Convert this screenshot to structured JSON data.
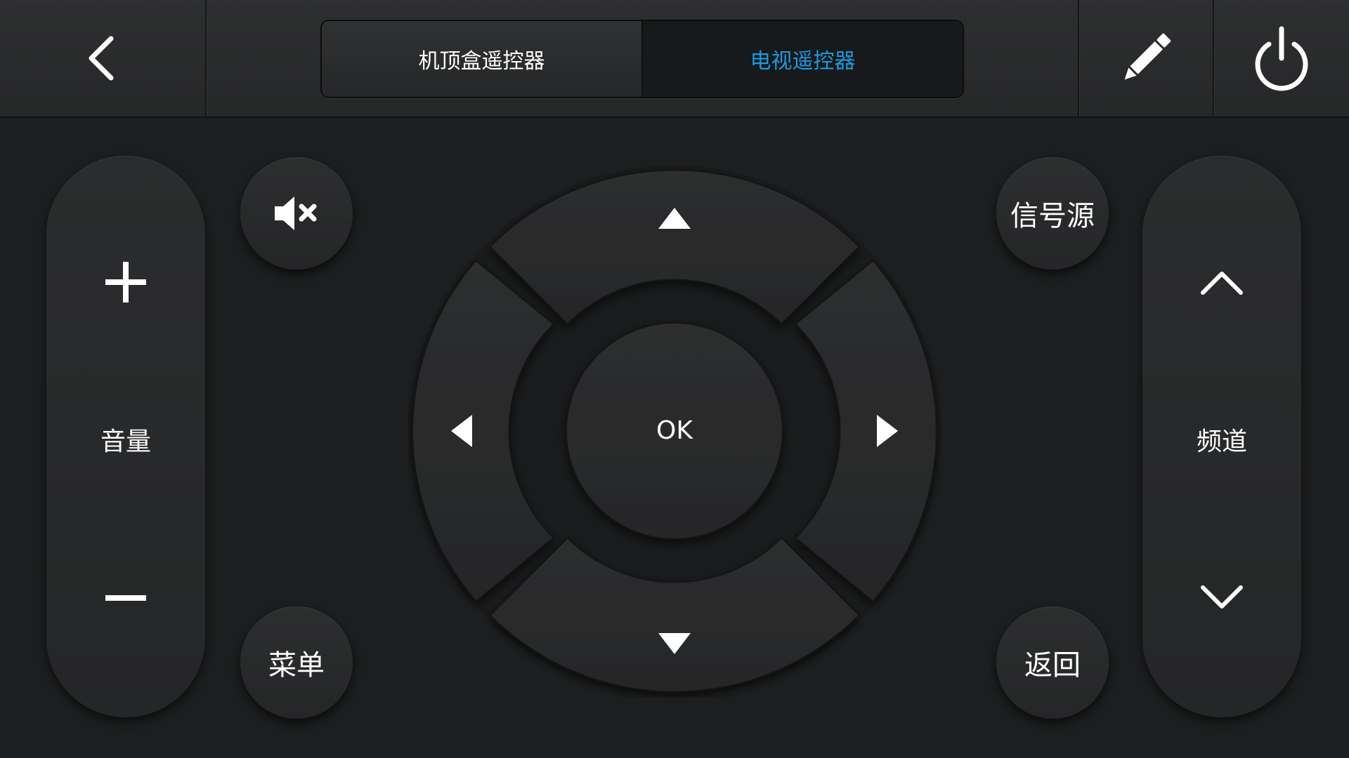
{
  "header": {
    "tabs": [
      {
        "label": "机顶盒遥控器",
        "active": false
      },
      {
        "label": "电视遥控器",
        "active": true
      }
    ],
    "active_color": "#1a9ae0"
  },
  "controls": {
    "volume_label": "音量",
    "channel_label": "频道",
    "menu_label": "菜单",
    "source_label": "信号源",
    "back_label": "返回",
    "ok_label": "OK"
  },
  "icons": [
    "back-arrow-icon",
    "pencil-icon",
    "power-icon",
    "mute-icon",
    "plus-icon",
    "minus-icon",
    "chevron-up-icon",
    "chevron-down-icon",
    "triangle-up-icon",
    "triangle-down-icon",
    "triangle-left-icon",
    "triangle-right-icon"
  ]
}
